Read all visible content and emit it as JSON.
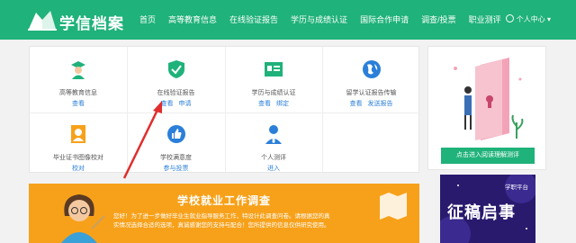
{
  "header": {
    "brand": "学信档案",
    "nav": [
      "首页",
      "高等教育信息",
      "在线验证报告",
      "学历与成绩认证",
      "国际合作申请",
      "调查/投票",
      "职业测评"
    ],
    "user": "个人中心",
    "user_caret": "▾"
  },
  "services": [
    {
      "title": "高等教育信息",
      "links": [
        "查看"
      ],
      "icon": "graduate-icon"
    },
    {
      "title": "在线验证报告",
      "links": [
        "查看",
        "申请"
      ],
      "icon": "verify-shield-icon"
    },
    {
      "title": "学历与成绩认证",
      "links": [
        "查看",
        "绑定"
      ],
      "icon": "certificate-icon"
    },
    {
      "title": "留学认证报告传输",
      "links": [
        "查看",
        "发送报告"
      ],
      "icon": "globe-icon"
    },
    {
      "title": "毕业证书图像校对",
      "links": [
        "校对"
      ],
      "icon": "photo-id-icon"
    },
    {
      "title": "学校满意度",
      "links": [
        "参与投票"
      ],
      "icon": "thumbs-up-icon"
    },
    {
      "title": "个人测评",
      "links": [
        "进入"
      ],
      "icon": "person-tie-icon"
    }
  ],
  "survey": {
    "title": "学校就业工作调查",
    "text_a": "您好！为了进一步做好毕业生就业指导服务工作，特设计此调查问卷。请根据您的真",
    "text_b": "实情况选择合适的选项，真诚感谢您的支持与配合！您所提供的信息仅供研究使用。"
  },
  "sidebar": {
    "button": "点击进入阅读理解测评"
  },
  "ad": {
    "tag": "学职平台",
    "title": "征稿启事"
  },
  "colors": {
    "brand": "#1fb27a",
    "orange": "#f7a11a",
    "link": "#2b7fd9",
    "ad": "#2a1a6e"
  }
}
